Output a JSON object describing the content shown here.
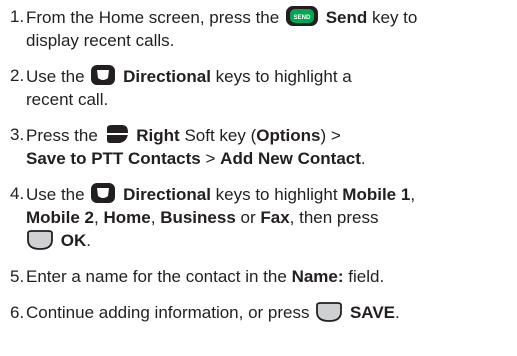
{
  "steps": [
    {
      "number": "1.",
      "t1": "From the Home screen, press the",
      "key": "Send",
      "t2": "key to",
      "t3": "display recent calls.",
      "icon": "send-key-icon",
      "icon_label": "SEND"
    },
    {
      "number": "2.",
      "t1": "Use the",
      "key": "Directional",
      "t2": "keys to highlight a",
      "t3": "recent call.",
      "icon": "directional-key-icon"
    },
    {
      "number": "3.",
      "t1": "Press the",
      "key": "Right",
      "t2": "Soft key (",
      "options": "Options",
      "t3": ") >",
      "save_to_ptt": "Save to PTT Contacts",
      "gt": ">",
      "add_new_contact": "Add New Contact",
      "period": ".",
      "icon": "right-soft-key-icon"
    },
    {
      "number": "4.",
      "t1": "Use the",
      "key": "Directional",
      "t2": "keys to highlight",
      "mobile1": "Mobile 1",
      "comma1": ",",
      "mobile2": "Mobile 2",
      "comma2": ",",
      "home": "Home",
      "comma3": ",",
      "business": "Business",
      "or": "or",
      "fax": "Fax",
      "t3": ", then press",
      "ok": "OK",
      "period": ".",
      "icon": "directional-key-icon",
      "ok_icon": "ok-key-icon"
    },
    {
      "number": "5.",
      "t1": "Enter a name for the contact in the",
      "field": "Name:",
      "t2": "field.",
      "period": ""
    },
    {
      "number": "6.",
      "t1": "Continue adding information, or press",
      "save": "SAVE",
      "period": ".",
      "icon": "save-key-icon"
    }
  ]
}
